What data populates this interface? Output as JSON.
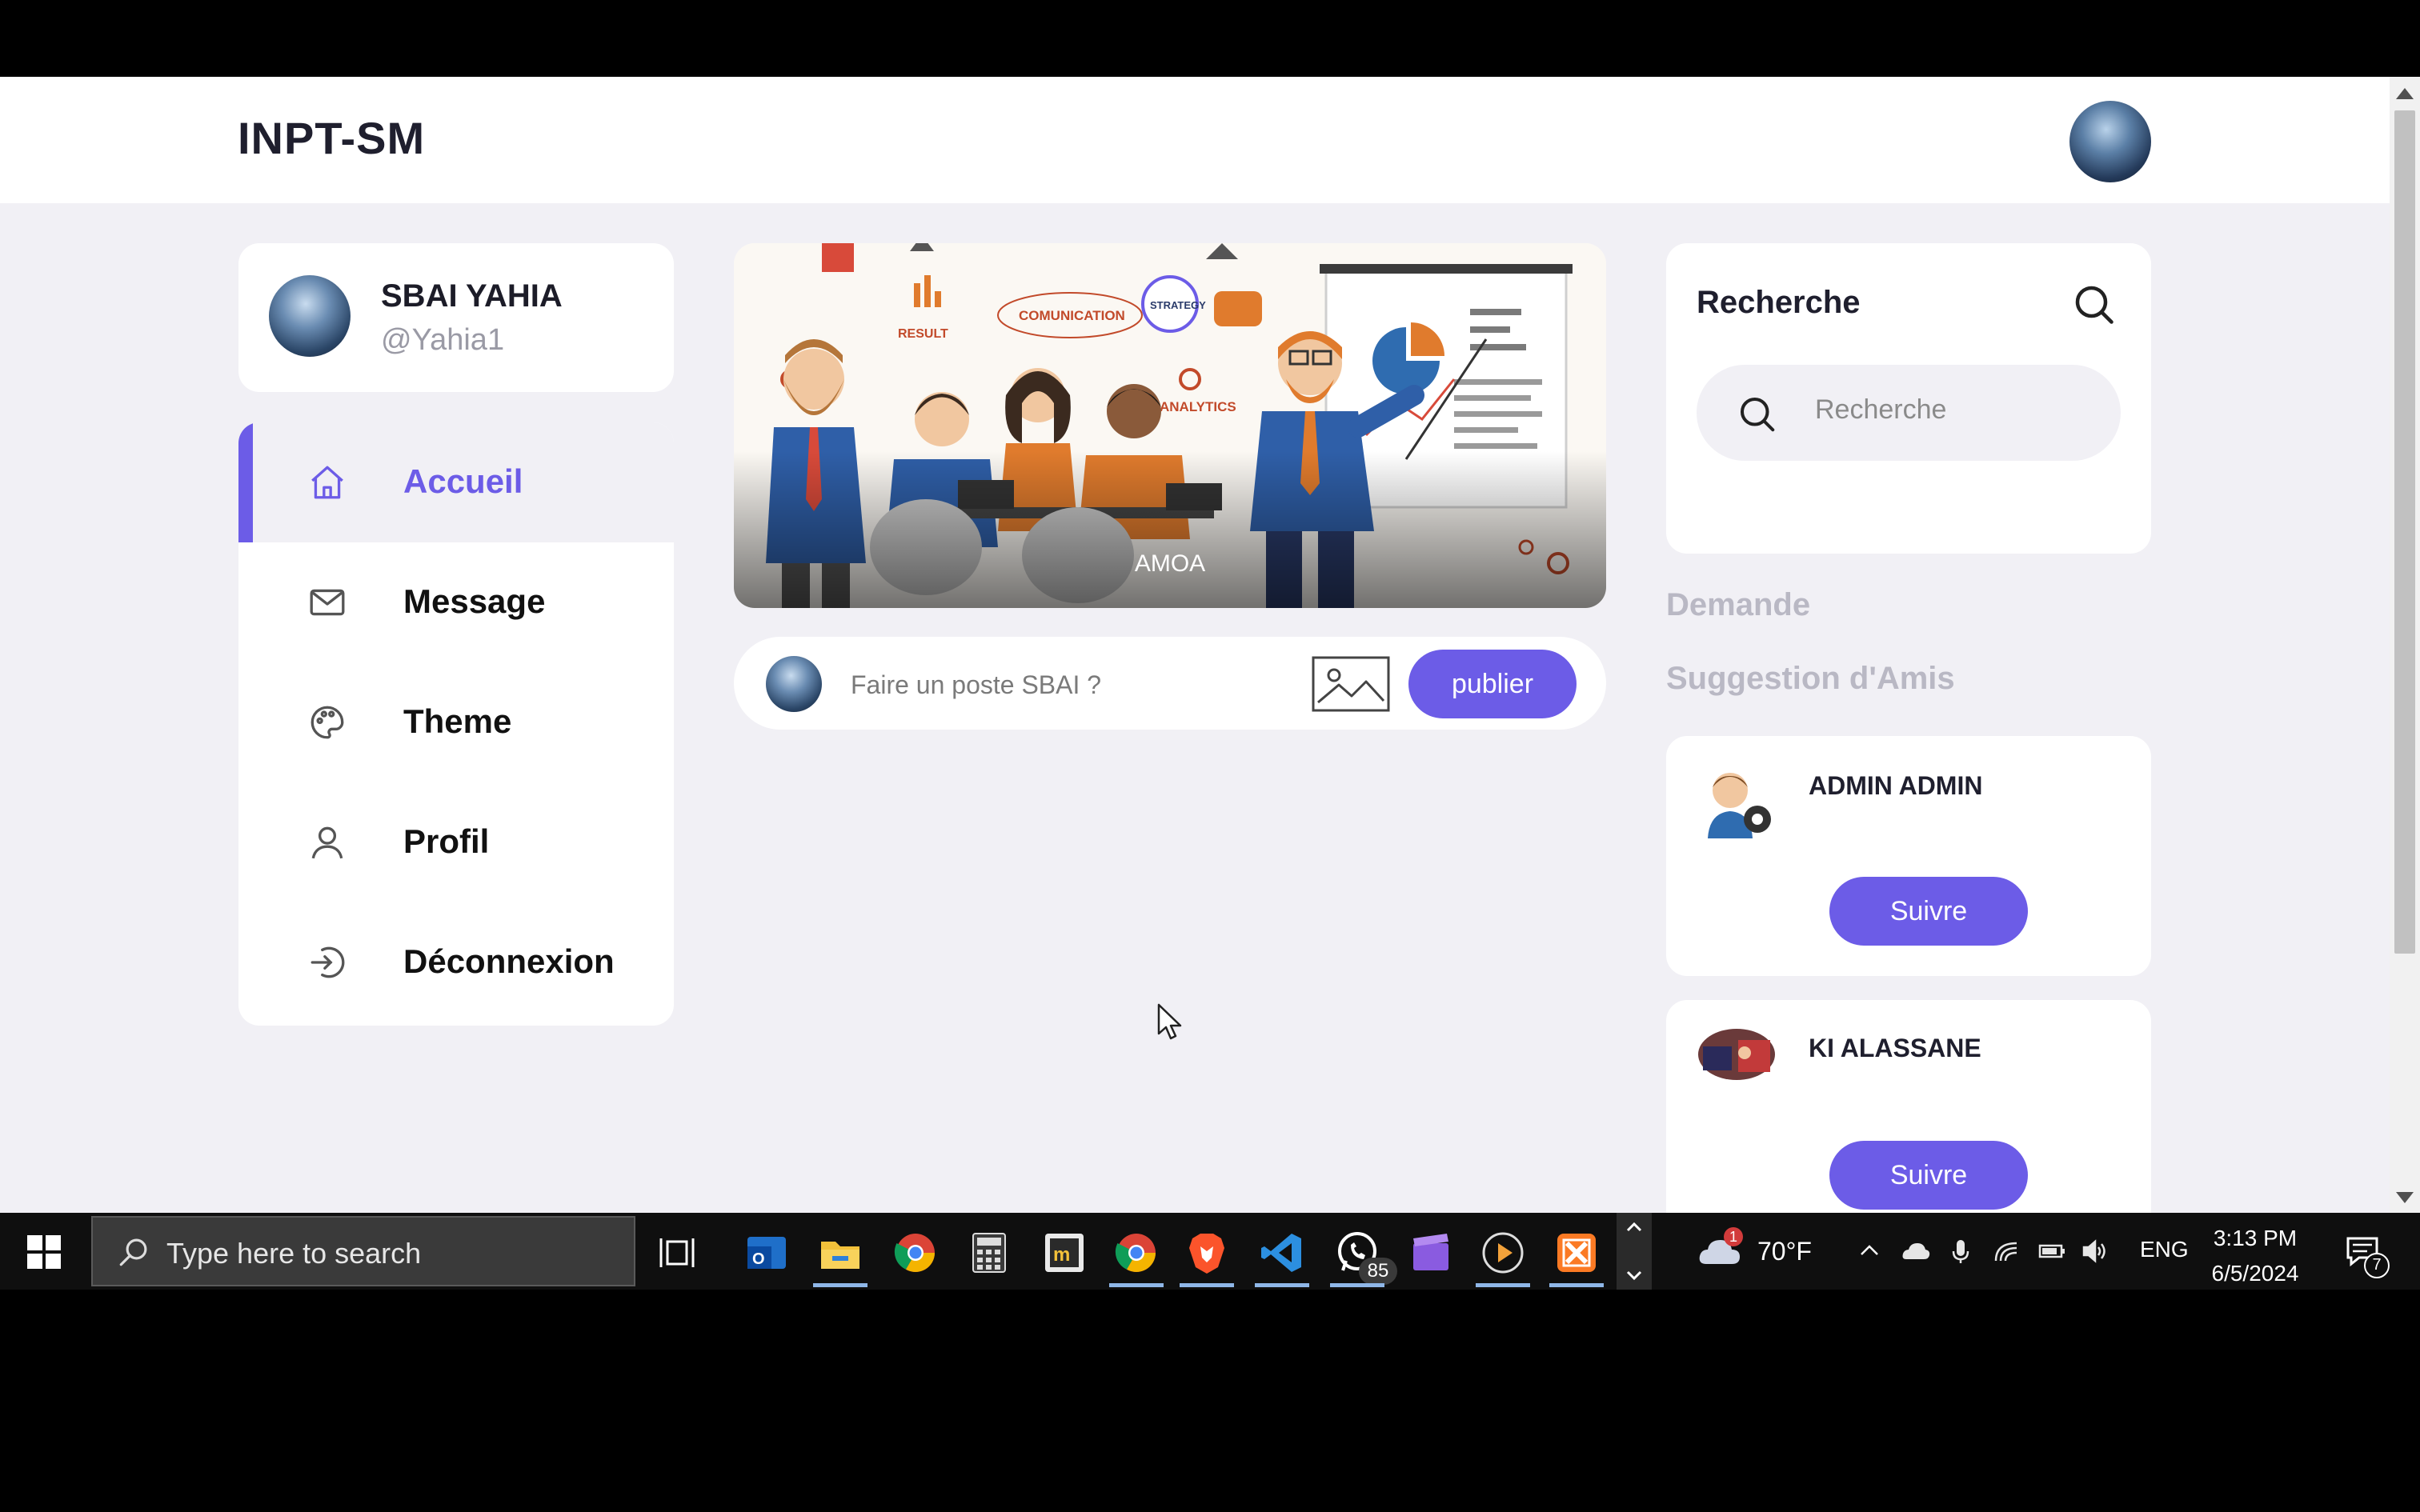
{
  "app": {
    "brand": "INPT-SM"
  },
  "profile": {
    "name": "SBAI YAHIA",
    "handle": "@Yahia1"
  },
  "menu": {
    "items": [
      {
        "label": "Accueil",
        "icon": "home-icon",
        "active": true
      },
      {
        "label": "Message",
        "icon": "mail-icon",
        "active": false
      },
      {
        "label": "Theme",
        "icon": "palette-icon",
        "active": false
      },
      {
        "label": "Profil",
        "icon": "user-icon",
        "active": false
      },
      {
        "label": "Déconnexion",
        "icon": "logout-icon",
        "active": false
      }
    ]
  },
  "story": {
    "label": "AMOA"
  },
  "illustration": {
    "words": [
      "RESULT",
      "COMUNICATION",
      "ANALYTICS",
      "STRATEGY"
    ]
  },
  "post": {
    "placeholder": "Faire un poste SBAI ?",
    "publish_label": "publier"
  },
  "search": {
    "title": "Recherche",
    "placeholder": "Recherche"
  },
  "sections": {
    "requests": "Demande",
    "suggestions": "Suggestion d'Amis"
  },
  "suggestions": [
    {
      "name": "ADMIN ADMIN",
      "follow_label": "Suivre"
    },
    {
      "name": "KI ALASSANE",
      "follow_label": "Suivre"
    }
  ],
  "taskbar": {
    "search_placeholder": "Type here to search",
    "whatsapp_badge": "85",
    "weather_badge": "1",
    "temperature": "70°F",
    "language": "ENG",
    "time": "3:13 PM",
    "date": "6/5/2024",
    "notifications": "7"
  },
  "colors": {
    "accent": "#6c5ce7",
    "background": "#f1f0f5",
    "card": "#ffffff",
    "muted_heading": "#b9b8c4"
  }
}
